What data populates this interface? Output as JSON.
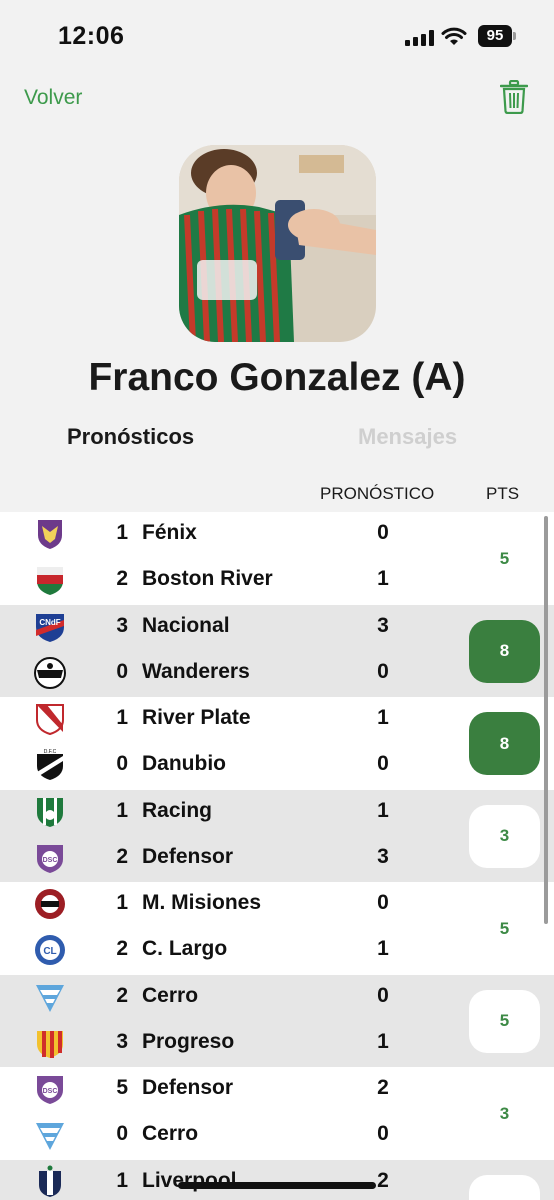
{
  "status": {
    "time": "12:06",
    "battery": "95"
  },
  "nav": {
    "back_label": "Volver"
  },
  "profile": {
    "name": "Franco Gonzalez (A)"
  },
  "tabs": {
    "active": "Pronósticos",
    "inactive": "Mensajes"
  },
  "table": {
    "pron_header": "PRONÓSTICO",
    "pts_header": "PTS"
  },
  "matches": [
    {
      "pts": "5",
      "pts_style": "plain",
      "bg": "white",
      "teams": [
        {
          "goals": "1",
          "name": "Fénix",
          "pred": "0",
          "crest": "fenix-crest"
        },
        {
          "goals": "2",
          "name": "Boston River",
          "pred": "1",
          "crest": "boston-river-crest"
        }
      ]
    },
    {
      "pts": "8",
      "pts_style": "green",
      "bg": "grey",
      "teams": [
        {
          "goals": "3",
          "name": "Nacional",
          "pred": "3",
          "crest": "nacional-crest"
        },
        {
          "goals": "0",
          "name": "Wanderers",
          "pred": "0",
          "crest": "wanderers-crest"
        }
      ]
    },
    {
      "pts": "8",
      "pts_style": "green",
      "bg": "white",
      "teams": [
        {
          "goals": "1",
          "name": "River Plate",
          "pred": "1",
          "crest": "river-plate-crest"
        },
        {
          "goals": "0",
          "name": "Danubio",
          "pred": "0",
          "crest": "danubio-crest"
        }
      ]
    },
    {
      "pts": "3",
      "pts_style": "white",
      "bg": "grey",
      "teams": [
        {
          "goals": "1",
          "name": "Racing",
          "pred": "1",
          "crest": "racing-crest"
        },
        {
          "goals": "2",
          "name": "Defensor",
          "pred": "3",
          "crest": "defensor-crest"
        }
      ]
    },
    {
      "pts": "5",
      "pts_style": "plain",
      "bg": "white",
      "teams": [
        {
          "goals": "1",
          "name": "M. Misiones",
          "pred": "0",
          "crest": "miramar-misiones-crest"
        },
        {
          "goals": "2",
          "name": "C. Largo",
          "pred": "1",
          "crest": "cerro-largo-crest"
        }
      ]
    },
    {
      "pts": "5",
      "pts_style": "white",
      "bg": "grey",
      "teams": [
        {
          "goals": "2",
          "name": "Cerro",
          "pred": "0",
          "crest": "cerro-crest"
        },
        {
          "goals": "3",
          "name": "Progreso",
          "pred": "1",
          "crest": "progreso-crest"
        }
      ]
    },
    {
      "pts": "3",
      "pts_style": "plain",
      "bg": "white",
      "teams": [
        {
          "goals": "5",
          "name": "Defensor",
          "pred": "2",
          "crest": "defensor-crest"
        },
        {
          "goals": "0",
          "name": "Cerro",
          "pred": "0",
          "crest": "cerro-crest"
        }
      ]
    },
    {
      "pts": "",
      "pts_style": "white",
      "bg": "grey",
      "teams": [
        {
          "goals": "1",
          "name": "Liverpool",
          "pred": "2",
          "crest": "liverpool-crest"
        },
        {
          "goals": "",
          "name": "",
          "pred": "",
          "crest": ""
        }
      ]
    }
  ],
  "colors": {
    "accent": "#3d9a4c",
    "pts_green": "#3a7f3f",
    "row_grey": "#e6e6e6"
  }
}
